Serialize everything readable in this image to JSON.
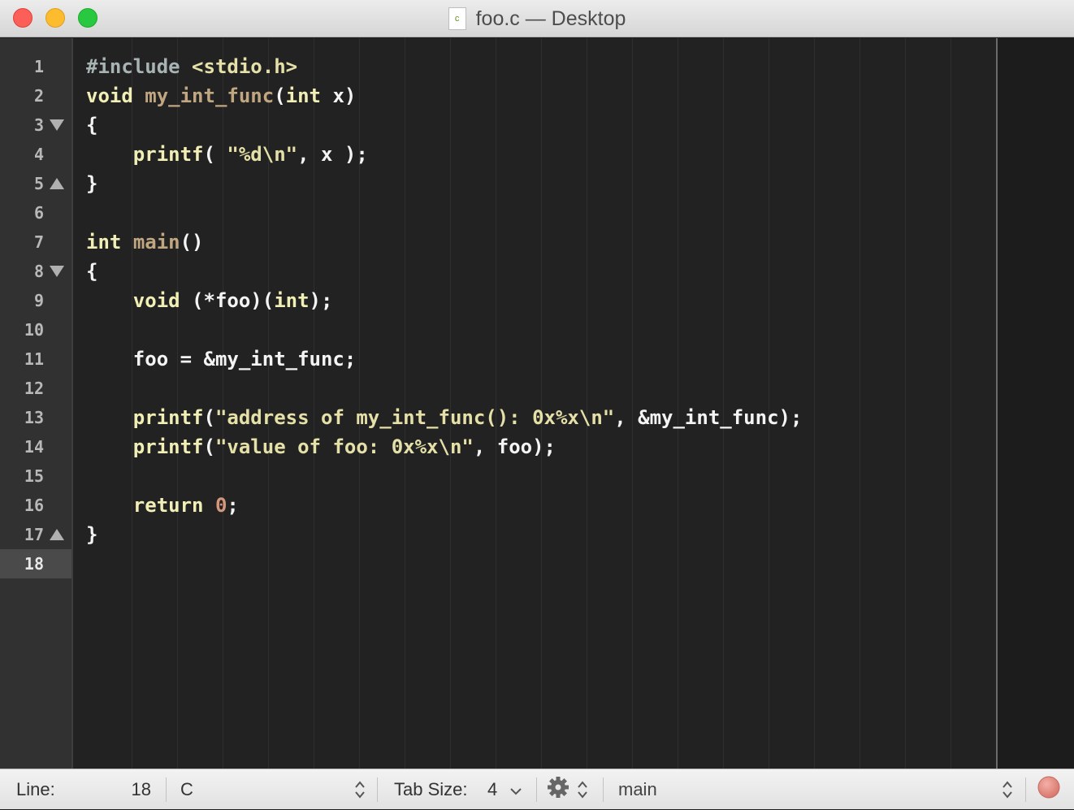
{
  "window": {
    "title": "foo.c — Desktop",
    "file_icon_label": "c"
  },
  "gutter": {
    "line_numbers": [
      "1",
      "2",
      "3",
      "4",
      "5",
      "6",
      "7",
      "8",
      "9",
      "10",
      "11",
      "12",
      "13",
      "14",
      "15",
      "16",
      "17",
      "18"
    ],
    "current_line": "18"
  },
  "code": {
    "lines": [
      "#include <stdio.h>",
      "void my_int_func(int x)",
      "{",
      "    printf( \"%d\\n\", x );",
      "}",
      "",
      "int main()",
      "{",
      "    void (*foo)(int);",
      "",
      "    foo = &my_int_func;",
      "",
      "    printf(\"address of my_int_func(): 0x%x\\n\", &my_int_func);",
      "    printf(\"value of foo: 0x%x\\n\", foo);",
      "",
      "    return 0;",
      "}",
      ""
    ]
  },
  "statusbar": {
    "line_label": "Line:",
    "line_value": "18",
    "language": "C",
    "tab_size_label": "Tab Size:",
    "tab_size_value": "4",
    "symbol": "main"
  },
  "colors": {
    "keyword": "#f1efb5",
    "function": "#c0a781",
    "string": "#e5e0a8",
    "number": "#d4977b",
    "background": "#222222",
    "gutter": "#313131"
  }
}
